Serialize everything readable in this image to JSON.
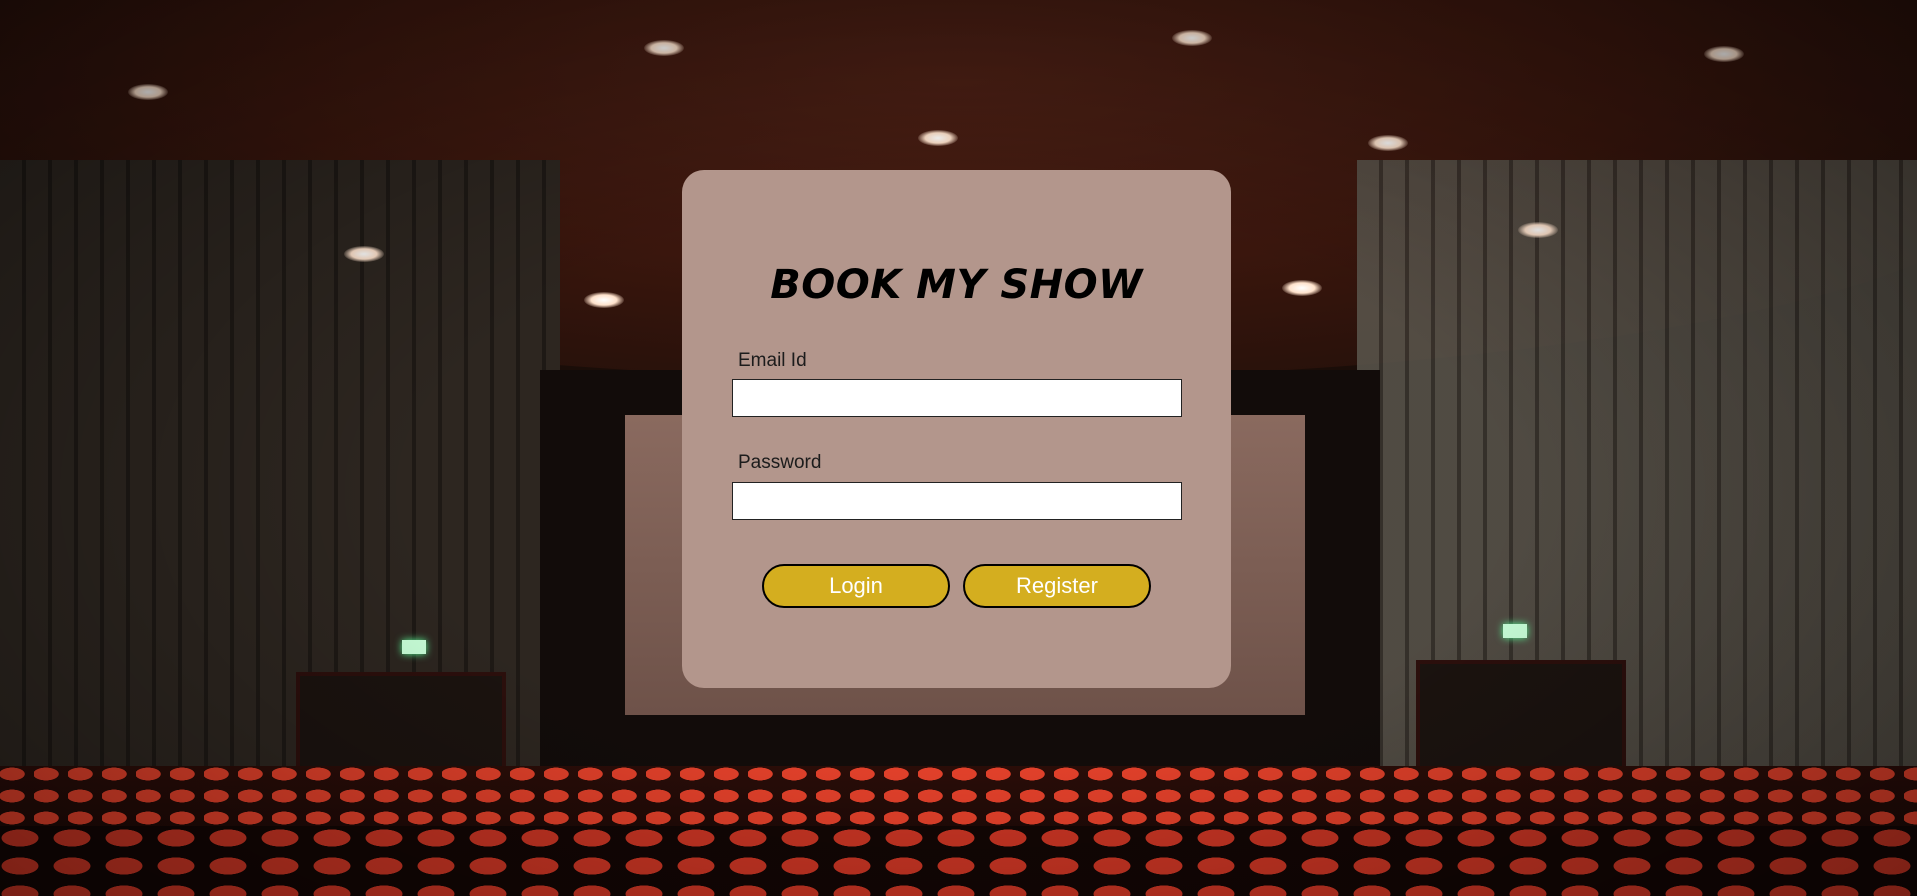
{
  "app": {
    "title": "BOOK MY SHOW"
  },
  "form": {
    "email_label": "Email Id",
    "email_value": "",
    "password_label": "Password",
    "password_value": "",
    "login_label": "Login",
    "register_label": "Register"
  },
  "colors": {
    "card_background": "#b3968c",
    "button_background": "#d4ae1f",
    "button_text": "#ffffff"
  }
}
